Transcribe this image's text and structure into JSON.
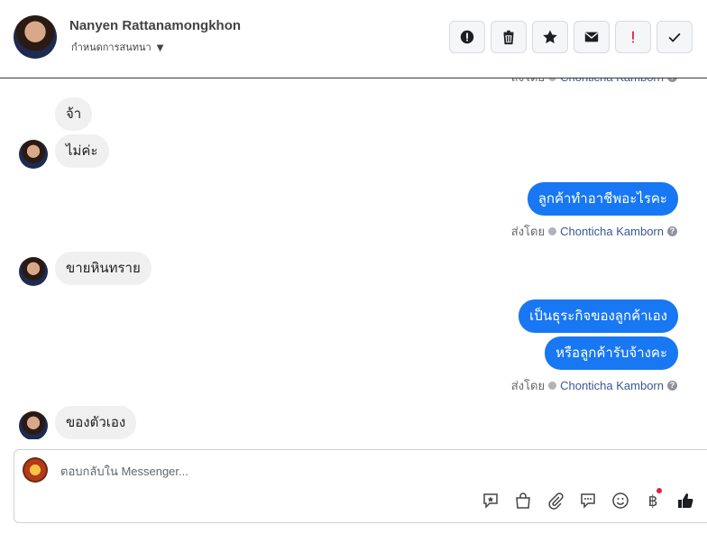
{
  "header": {
    "contact_name": "Nanyen Rattanamongkhon",
    "subtitle": "กำหนดการสนทนา",
    "actions": [
      {
        "name": "mark-spam-button",
        "icon": "alert-circle-icon"
      },
      {
        "name": "delete-button",
        "icon": "trash-icon"
      },
      {
        "name": "star-button",
        "icon": "star-icon"
      },
      {
        "name": "mark-unread-button",
        "icon": "envelope-icon"
      },
      {
        "name": "important-button",
        "icon": "exclamation-icon",
        "color": "#e41e3f"
      },
      {
        "name": "mark-done-button",
        "icon": "check-icon"
      }
    ]
  },
  "thread": {
    "sent_by_prefix": "ส่งโดย",
    "sender_name": "Chonticha Kamborn",
    "messages": [
      {
        "dir": "in",
        "text": "จ้า"
      },
      {
        "dir": "in",
        "text": "ไม่ค่ะ"
      },
      {
        "dir": "out",
        "text": "ลูกค้าทำอาชีพอะไรคะ"
      },
      {
        "dir": "in",
        "text": "ขายหินทราย"
      },
      {
        "dir": "out",
        "text": "เป็นธุระกิจของลูกค้าเอง"
      },
      {
        "dir": "out",
        "text": "หรือลูกค้ารับจ้างคะ"
      },
      {
        "dir": "in",
        "text": "ของตัวเอง"
      }
    ]
  },
  "composer": {
    "placeholder": "ตอบกลับใน Messenger...",
    "tools": [
      "saved-reply-icon",
      "shop-bag-icon",
      "attachment-icon",
      "chat-bubble-icon",
      "emoji-icon",
      "baht-payment-icon",
      "like-icon"
    ]
  },
  "colors": {
    "accent": "#1877f2",
    "incoming_bubble": "#f0f0f0",
    "badge": "#e41e3f"
  }
}
